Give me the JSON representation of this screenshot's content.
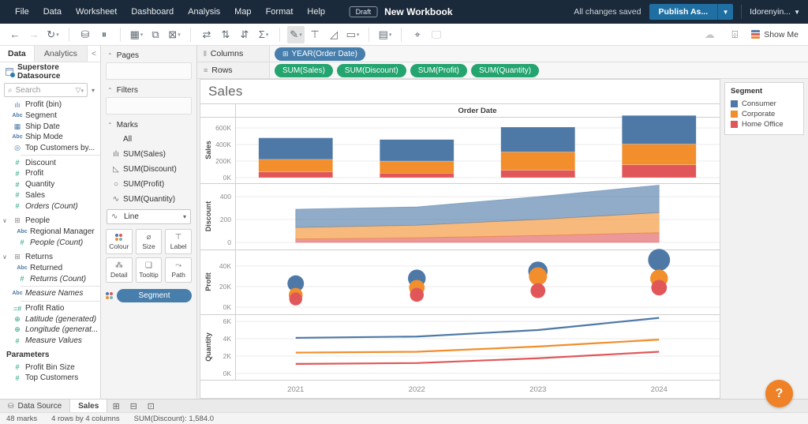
{
  "app": {
    "menu": [
      "File",
      "Data",
      "Worksheet",
      "Dashboard",
      "Analysis",
      "Map",
      "Format",
      "Help"
    ],
    "draft_badge": "Draft",
    "workbook_title": "New Workbook",
    "saved_status": "All changes saved",
    "publish_label": "Publish As...",
    "user_label": "Idorenyin...",
    "show_me_label": "Show Me",
    "toolbar_icons": [
      {
        "name": "back-icon",
        "glyph": "←",
        "state": "normal"
      },
      {
        "name": "forward-icon",
        "glyph": "→",
        "state": "disabled"
      },
      {
        "name": "redo-icon",
        "glyph": "↻",
        "caret": true,
        "state": "normal"
      },
      {
        "name": "sep"
      },
      {
        "name": "new-data-source-icon",
        "glyph": "⛁",
        "state": "normal"
      },
      {
        "name": "pause-updates-icon",
        "glyph": "⏸",
        "state": "normal"
      },
      {
        "name": "sep"
      },
      {
        "name": "new-worksheet-icon",
        "glyph": "▦",
        "caret": true,
        "state": "normal"
      },
      {
        "name": "duplicate-icon",
        "glyph": "⧉",
        "state": "normal"
      },
      {
        "name": "clear-sheet-icon",
        "glyph": "⊠",
        "caret": true,
        "state": "normal"
      },
      {
        "name": "sep"
      },
      {
        "name": "swap-axes-icon",
        "glyph": "⇄",
        "state": "normal"
      },
      {
        "name": "sort-ascending-icon",
        "glyph": "⇅",
        "state": "normal"
      },
      {
        "name": "sort-descending-icon",
        "glyph": "⇵",
        "state": "normal"
      },
      {
        "name": "totals-icon",
        "glyph": "Σ",
        "caret": true,
        "state": "normal"
      },
      {
        "name": "sep"
      },
      {
        "name": "highlight-icon",
        "glyph": "✎",
        "caret": true,
        "state": "active"
      },
      {
        "name": "show-mark-labels-icon",
        "glyph": "⊤",
        "state": "normal"
      },
      {
        "name": "annotate-icon",
        "glyph": "◿",
        "state": "normal"
      },
      {
        "name": "fit-icon",
        "glyph": "▭",
        "caret": true,
        "state": "normal"
      },
      {
        "name": "sep"
      },
      {
        "name": "show-hide-cards-icon",
        "glyph": "▤",
        "caret": true,
        "state": "normal"
      },
      {
        "name": "sep"
      },
      {
        "name": "download-icon",
        "glyph": "⌖",
        "state": "normal"
      },
      {
        "name": "presentation-mode-icon",
        "glyph": "🖵",
        "state": "disabled"
      }
    ],
    "right_icons": [
      {
        "name": "cloud-icon",
        "glyph": "☁"
      },
      {
        "name": "tooltip-mode-icon",
        "glyph": "⌹"
      }
    ]
  },
  "datapane": {
    "tab_data": "Data",
    "tab_analytics": "Analytics",
    "collapse_glyph": "<",
    "datasource_name": "Superstore Datasource",
    "search_placeholder": "Search",
    "fields": [
      {
        "icon": "histogram-icon",
        "icolor": "blue",
        "glyph": "ılı",
        "label": "Profit (bin)"
      },
      {
        "icon": "abc-icon",
        "icolor": "blue",
        "glyph": "Abc",
        "label": "Segment"
      },
      {
        "icon": "calendar-icon",
        "icolor": "blue",
        "glyph": "▦",
        "label": "Ship Date"
      },
      {
        "icon": "abc-icon",
        "icolor": "blue",
        "glyph": "Abc",
        "label": "Ship Mode"
      },
      {
        "icon": "set-icon",
        "icolor": "blue",
        "glyph": "◎",
        "label": "Top Customers by..."
      },
      {
        "sep": true
      },
      {
        "icon": "number-icon",
        "icolor": "green",
        "glyph": "#",
        "label": "Discount"
      },
      {
        "icon": "number-icon",
        "icolor": "green",
        "glyph": "#",
        "label": "Profit"
      },
      {
        "icon": "number-icon",
        "icolor": "green",
        "glyph": "#",
        "label": "Quantity"
      },
      {
        "icon": "number-icon",
        "icolor": "green",
        "glyph": "#",
        "label": "Sales"
      },
      {
        "icon": "number-icon",
        "icolor": "green",
        "glyph": "#",
        "label": "Orders (Count)",
        "italic": true
      },
      {
        "gap": true
      },
      {
        "icon": "table-icon",
        "icolor": "gray",
        "glyph": "⊞",
        "label": "People",
        "group": true
      },
      {
        "icon": "abc-icon",
        "icolor": "blue",
        "glyph": "Abc",
        "label": "Regional Manager",
        "child": true
      },
      {
        "icon": "number-icon",
        "icolor": "green",
        "glyph": "#",
        "label": "People (Count)",
        "italic": true,
        "child": true
      },
      {
        "gap": true
      },
      {
        "icon": "table-icon",
        "icolor": "gray",
        "glyph": "⊞",
        "label": "Returns",
        "group": true
      },
      {
        "icon": "abc-icon",
        "icolor": "blue",
        "glyph": "Abc",
        "label": "Returned",
        "child": true
      },
      {
        "icon": "number-icon",
        "icolor": "green",
        "glyph": "#",
        "label": "Returns (Count)",
        "italic": true,
        "child": true
      },
      {
        "sep": true
      },
      {
        "icon": "abc-icon",
        "icolor": "blue",
        "glyph": "Abc",
        "label": "Measure Names",
        "italic": true
      },
      {
        "sep": true
      },
      {
        "icon": "calc-number-icon",
        "icolor": "green",
        "glyph": "=#",
        "label": "Profit Ratio"
      },
      {
        "icon": "globe-icon",
        "icolor": "green",
        "glyph": "⊕",
        "label": "Latitude (generated)",
        "italic": true
      },
      {
        "icon": "globe-icon",
        "icolor": "green",
        "glyph": "⊕",
        "label": "Longitude (generat...",
        "italic": true
      },
      {
        "icon": "number-icon",
        "icolor": "green",
        "glyph": "#",
        "label": "Measure Values",
        "italic": true
      }
    ],
    "parameters_header": "Parameters",
    "parameters": [
      {
        "icon": "number-icon",
        "icolor": "green",
        "glyph": "#",
        "label": "Profit Bin Size"
      },
      {
        "icon": "number-icon",
        "icolor": "green",
        "glyph": "#",
        "label": "Top Customers"
      }
    ]
  },
  "marks": {
    "pages_label": "Pages",
    "filters_label": "Filters",
    "marks_label": "Marks",
    "items": [
      {
        "icon": "all",
        "glyph": "",
        "label": "All"
      },
      {
        "icon": "bar-chart-icon",
        "glyph": "ılı",
        "label": "SUM(Sales)"
      },
      {
        "icon": "area-chart-icon",
        "glyph": "◺",
        "label": "SUM(Discount)"
      },
      {
        "icon": "circle-chart-icon",
        "glyph": "○",
        "label": "SUM(Profit)"
      },
      {
        "icon": "line-chart-icon",
        "glyph": "∿",
        "label": "SUM(Quantity)"
      },
      {
        "icon": "line-chart-icon",
        "glyph": "∿",
        "label": "Line",
        "select": true
      }
    ],
    "buttons": [
      {
        "name": "colour-button",
        "label": "Colour",
        "icon": "colour-dots-icon"
      },
      {
        "name": "size-button",
        "label": "Size",
        "icon": "size-icon",
        "glyph": "⌀"
      },
      {
        "name": "label-button",
        "label": "Label",
        "icon": "label-icon",
        "glyph": "⊤"
      },
      {
        "name": "detail-button",
        "label": "Detail",
        "icon": "detail-icon",
        "glyph": "⁂"
      },
      {
        "name": "tooltip-button",
        "label": "Tooltip",
        "icon": "tooltip-icon",
        "glyph": "❏"
      },
      {
        "name": "path-button",
        "label": "Path",
        "icon": "path-icon",
        "glyph": "⤳"
      }
    ],
    "segment_pill": "Segment"
  },
  "shelves": {
    "columns_label": "Columns",
    "rows_label": "Rows",
    "columns_pills": [
      {
        "label": "YEAR(Order Date)",
        "prefix": "⊞"
      }
    ],
    "rows_pills": [
      {
        "label": "SUM(Sales)"
      },
      {
        "label": "SUM(Discount)"
      },
      {
        "label": "SUM(Profit)"
      },
      {
        "label": "SUM(Quantity)"
      }
    ]
  },
  "view": {
    "sheet_title": "Sales",
    "column_header": "Order Date",
    "years": [
      "2021",
      "2022",
      "2023",
      "2024"
    ]
  },
  "legend": {
    "title": "Segment",
    "items": [
      {
        "label": "Consumer",
        "color": "#4e79a7"
      },
      {
        "label": "Corporate",
        "color": "#f28e2b"
      },
      {
        "label": "Home Office",
        "color": "#e15759"
      }
    ]
  },
  "chart_data": [
    {
      "type": "bar",
      "stacked": true,
      "ylabel": "Sales",
      "categories": [
        "2021",
        "2022",
        "2023",
        "2024"
      ],
      "ylim": [
        0,
        760
      ],
      "yticks": [
        {
          "label": "0K",
          "v": 0
        },
        {
          "label": "200K",
          "v": 200
        },
        {
          "label": "400K",
          "v": 400
        },
        {
          "label": "600K",
          "v": 600
        }
      ],
      "series": [
        {
          "name": "Consumer",
          "color": "#4e79a7",
          "values": [
            260,
            260,
            300,
            345
          ]
        },
        {
          "name": "Corporate",
          "color": "#f28e2b",
          "values": [
            150,
            145,
            220,
            250
          ]
        },
        {
          "name": "Home Office",
          "color": "#e15759",
          "values": [
            70,
            55,
            90,
            155
          ]
        }
      ],
      "stack_bottom_to_top": [
        "Home Office",
        "Corporate",
        "Consumer"
      ],
      "units": "K"
    },
    {
      "type": "area",
      "stacked": true,
      "ylabel": "Discount",
      "categories": [
        "2021",
        "2022",
        "2023",
        "2024"
      ],
      "ylim": [
        0,
        560
      ],
      "yticks": [
        {
          "label": "0",
          "v": 0
        },
        {
          "label": "200",
          "v": 200
        },
        {
          "label": "400",
          "v": 400
        }
      ],
      "series": [
        {
          "name": "Consumer",
          "color": "#4e79a7",
          "values": [
            160,
            160,
            200,
            240
          ]
        },
        {
          "name": "Corporate",
          "color": "#f28e2b",
          "values": [
            100,
            110,
            140,
            175
          ]
        },
        {
          "name": "Home Office",
          "color": "#e15759",
          "values": [
            30,
            40,
            60,
            85
          ]
        }
      ],
      "stack_bottom_to_top": [
        "Home Office",
        "Corporate",
        "Consumer"
      ],
      "units": ""
    },
    {
      "type": "scatter",
      "ylabel": "Profit",
      "categories": [
        "2021",
        "2022",
        "2023",
        "2024"
      ],
      "ylim": [
        0,
        56
      ],
      "yticks": [
        {
          "label": "0K",
          "v": 0
        },
        {
          "label": "20K",
          "v": 20
        },
        {
          "label": "40K",
          "v": 40
        }
      ],
      "series": [
        {
          "name": "Consumer",
          "color": "#4e79a7",
          "values": [
            23,
            28,
            35,
            46
          ]
        },
        {
          "name": "Corporate",
          "color": "#f28e2b",
          "values": [
            12,
            19,
            30,
            28
          ]
        },
        {
          "name": "Home Office",
          "color": "#e15759",
          "values": [
            8,
            12,
            16,
            19
          ]
        }
      ],
      "size_by_value": true,
      "units": "K"
    },
    {
      "type": "line",
      "ylabel": "Quantity",
      "categories": [
        "2021",
        "2022",
        "2023",
        "2024"
      ],
      "ylim": [
        0,
        7
      ],
      "yticks": [
        {
          "label": "0K",
          "v": 0
        },
        {
          "label": "2K",
          "v": 2
        },
        {
          "label": "4K",
          "v": 4
        },
        {
          "label": "6K",
          "v": 6
        }
      ],
      "series": [
        {
          "name": "Consumer",
          "color": "#4e79a7",
          "values": [
            4.1,
            4.25,
            5.0,
            6.4
          ]
        },
        {
          "name": "Corporate",
          "color": "#f28e2b",
          "values": [
            2.4,
            2.5,
            3.1,
            3.9
          ]
        },
        {
          "name": "Home Office",
          "color": "#e15759",
          "values": [
            1.1,
            1.2,
            1.75,
            2.5
          ]
        }
      ],
      "units": "K"
    }
  ],
  "sheet_tabs": {
    "data_source_label": "Data Source",
    "active_sheet_label": "Sales"
  },
  "status_bar": {
    "marks_count": "48 marks",
    "grid_size": "4 rows by 4 columns",
    "aggregate": "SUM(Discount): 1,584.0"
  },
  "help": {
    "fab_label": "?"
  },
  "colors": {
    "consumer": "#4e79a7",
    "corporate": "#f28e2b",
    "home_office": "#e15759",
    "pill_blue": "#477eab",
    "pill_green": "#24a46f",
    "header_bg": "#1b2a3b",
    "publish_button": "#1f6fa3",
    "help_fab": "#ef8226"
  }
}
